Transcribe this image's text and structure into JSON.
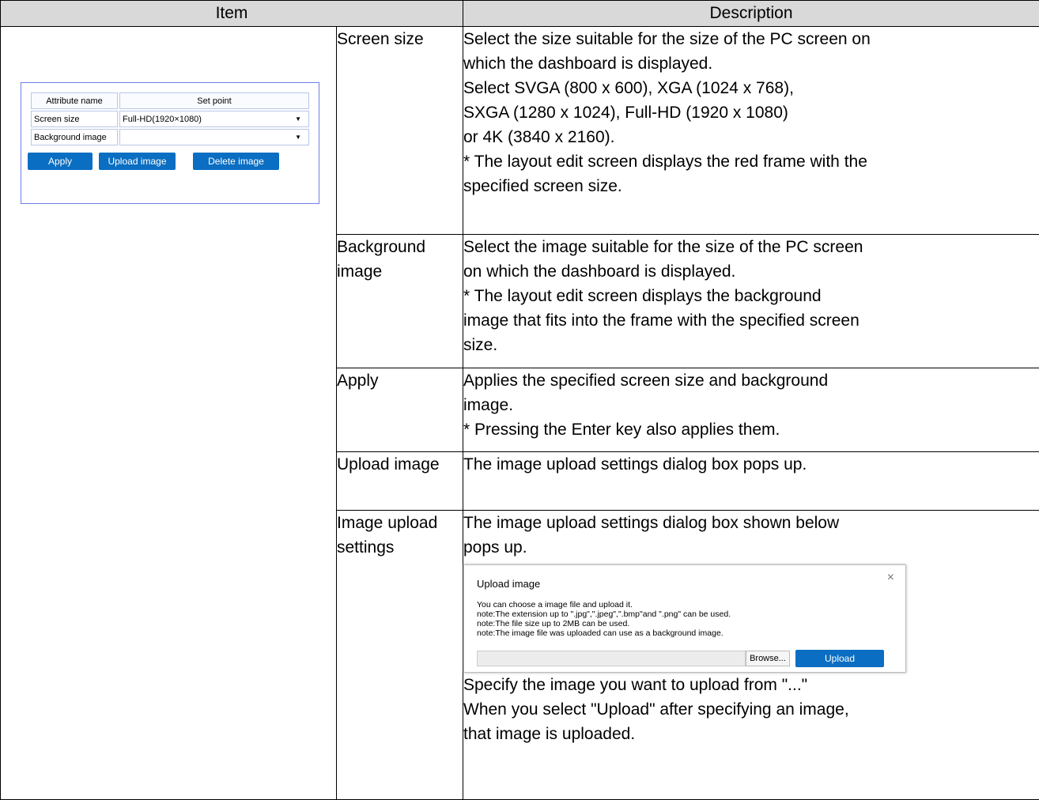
{
  "header": {
    "item": "Item",
    "description": "Description"
  },
  "panel": {
    "col_attr": "Attribute name",
    "col_set": "Set point",
    "screen_size_label": "Screen size",
    "screen_size_value": "Full-HD(1920×1080)",
    "background_label": "Background image",
    "background_value": "",
    "apply": "Apply",
    "upload": "Upload image",
    "delete": "Delete image"
  },
  "rows": [
    {
      "name": "Screen size",
      "lines": [
        "Select the size suitable for the size of the PC screen on",
        "which the dashboard is displayed.",
        "Select SVGA (800 x 600), XGA (1024 x 768),",
        "SXGA (1280 x 1024), Full-HD (1920 x 1080)",
        "or 4K (3840 x 2160).",
        "* The layout edit screen displays the red frame with the",
        "specified screen size."
      ]
    },
    {
      "name": "Background image",
      "lines": [
        "Select the image suitable for the size of the PC screen",
        "on which the dashboard is displayed.",
        "* The layout edit screen displays the background",
        "image that fits into the frame with the specified screen",
        "size."
      ]
    },
    {
      "name": "Apply",
      "lines": [
        "Applies the specified screen size and background",
        "image.",
        "* Pressing the Enter key also applies them."
      ]
    },
    {
      "name": "Upload image",
      "lines": [
        "The image upload settings dialog box pops up."
      ]
    },
    {
      "name": "Image upload settings",
      "lines_before": [
        "The image upload settings dialog box shown below",
        "pops up."
      ],
      "lines_after": [
        "Specify the image you want to upload from \"...\"",
        "When you select \"Upload\" after specifying an image,",
        "that image is uploaded."
      ]
    }
  ],
  "dialog": {
    "title": "Upload image",
    "close": "×",
    "lines": [
      "You can choose a image file and upload it.",
      "note:The extension up to \".jpg\",\".jpeg\",\".bmp\"and \".png\" can be used.",
      "note:The file size up to 2MB can be used.",
      "note:The image file was uploaded can use as a background image."
    ],
    "browse": "Browse...",
    "upload": "Upload"
  }
}
